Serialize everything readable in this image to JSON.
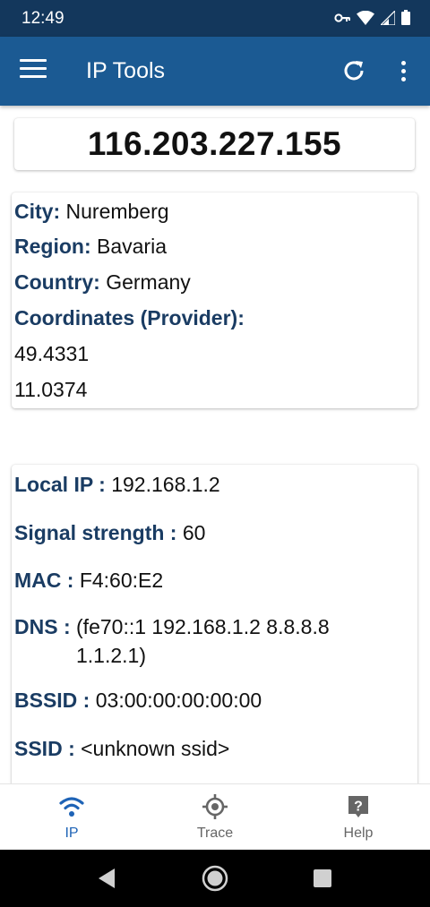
{
  "status_bar": {
    "time": "12:49",
    "icons": [
      "vpn-key-icon",
      "wifi-icon",
      "cellular-icon",
      "battery-icon"
    ]
  },
  "app_bar": {
    "title": "IP Tools",
    "icons": [
      "menu-icon",
      "refresh-icon",
      "more-vert-icon"
    ]
  },
  "ip_address": "116.203.227.155",
  "location": {
    "city_label": "City:",
    "city": "Nuremberg",
    "region_label": "Region:",
    "region": "Bavaria",
    "country_label": "Country:",
    "country": "Germany",
    "coordinates_label": "Coordinates (Provider):",
    "latitude": "49.4331",
    "longitude": "11.0374"
  },
  "network": {
    "local_ip_label": "Local IP :",
    "local_ip": "192.168.1.2",
    "signal_label": "Signal strength :",
    "signal": "60",
    "mac_label": "MAC :",
    "mac": "F4:60:E2",
    "dns_label": "DNS :",
    "dns_line1": "(fe70::1 192.168.1.2 8.8.8.8",
    "dns_line2": "1.1.2.1)",
    "bssid_label": "BSSID :",
    "bssid": "03:00:00:00:00:00",
    "ssid_label": "SSID :",
    "ssid": "<unknown ssid>"
  },
  "bottom_nav": {
    "items": [
      {
        "label": "IP",
        "icon": "wifi-icon",
        "active": true
      },
      {
        "label": "Trace",
        "icon": "crosshair-icon",
        "active": false
      },
      {
        "label": "Help",
        "icon": "help-icon",
        "active": false
      }
    ]
  },
  "system_nav": [
    "back-icon",
    "home-icon",
    "recents-icon"
  ],
  "colors": {
    "status_bar": "#13375c",
    "app_bar": "#1b5a93",
    "label": "#1a3c63",
    "nav_active": "#1e63b6",
    "nav_inactive": "#666666"
  }
}
